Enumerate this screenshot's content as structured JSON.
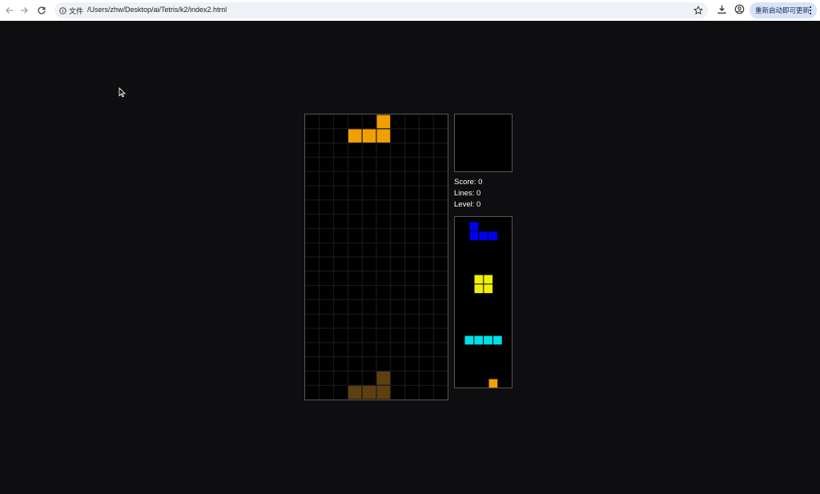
{
  "browser": {
    "site_label": "文件",
    "url": "/Users/zhw/Desktop/ai/Tetris/k2/index2.html",
    "update_button_label": "重新启动即可更新"
  },
  "game": {
    "board": {
      "cols": 10,
      "rows": 20,
      "grid_color": "#1c1c1c",
      "active_piece": {
        "type": "L",
        "color": "#f0a000",
        "cells": [
          [
            5,
            0
          ],
          [
            3,
            1
          ],
          [
            4,
            1
          ],
          [
            5,
            1
          ]
        ]
      },
      "ghost_piece": {
        "color": "#5e4010",
        "cells": [
          [
            5,
            18
          ],
          [
            3,
            19
          ],
          [
            4,
            19
          ],
          [
            5,
            19
          ]
        ]
      }
    },
    "hold": {
      "piece": null
    },
    "stats": {
      "score_label": "Score:",
      "score": "0",
      "lines_label": "Lines:",
      "lines": "0",
      "level_label": "Level:",
      "level": "0"
    },
    "next_queue": [
      {
        "type": "J",
        "color": "#0000f0",
        "cells": [
          [
            0,
            0
          ],
          [
            0,
            1
          ],
          [
            1,
            1
          ],
          [
            2,
            1
          ]
        ]
      },
      {
        "type": "O",
        "color": "#f0f000",
        "cells": [
          [
            0,
            0
          ],
          [
            1,
            0
          ],
          [
            0,
            1
          ],
          [
            1,
            1
          ]
        ]
      },
      {
        "type": "I",
        "color": "#00e0e8",
        "cells": [
          [
            0,
            0
          ],
          [
            1,
            0
          ],
          [
            2,
            0
          ],
          [
            3,
            0
          ]
        ]
      },
      {
        "type": "L",
        "color": "#f0a000",
        "cells": [
          [
            0,
            0
          ]
        ]
      }
    ]
  }
}
